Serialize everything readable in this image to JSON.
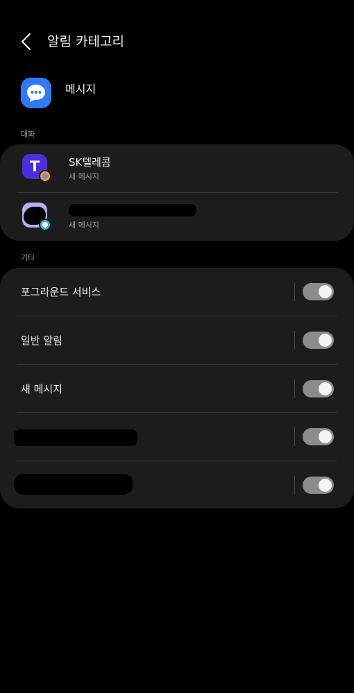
{
  "header": {
    "title": "알림 카테고리"
  },
  "app": {
    "name": "메시지",
    "icon": "chat-bubble-icon",
    "icon_color": "#2f79f2"
  },
  "sections": {
    "conversations": {
      "label": "대화",
      "items": [
        {
          "name": "SK텔레콤",
          "subtitle": "새 메시지",
          "avatar": "t-logo-avatar",
          "avatar_color": "#4a2fe0"
        },
        {
          "name": "",
          "subtitle": "새 메시지",
          "avatar": "contact-avatar",
          "avatar_color": "#b4b0f0"
        }
      ]
    },
    "other": {
      "label": "기타",
      "items": [
        {
          "label": "포그라운드 서비스",
          "enabled": true
        },
        {
          "label": "일반 알림",
          "enabled": true
        },
        {
          "label": "새 메시지",
          "enabled": true
        },
        {
          "label": "",
          "enabled": true
        },
        {
          "label": "",
          "enabled": true
        }
      ]
    }
  },
  "colors": {
    "background": "#000000",
    "card": "#1c1c1c",
    "toggle_track": "#8c8c8c",
    "toggle_knob": "#f4f4f4"
  }
}
